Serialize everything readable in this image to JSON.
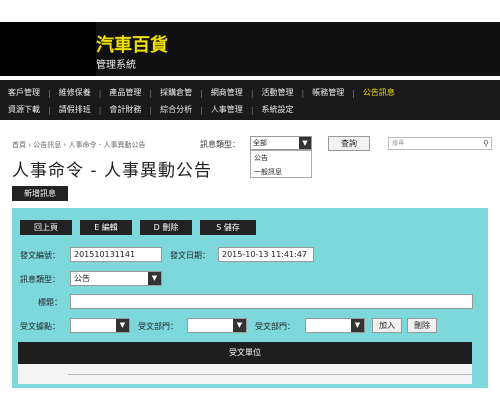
{
  "header": {
    "title": "汽車百貨",
    "subtitle": "管理系統"
  },
  "nav": {
    "row1": [
      "客戶管理",
      "維修保養",
      "產品管理",
      "採購倉管",
      "網商管理",
      "活動管理",
      "帳務管理",
      "公告訊息"
    ],
    "row2": [
      "資源下載",
      "請假排班",
      "會計財務",
      "綜合分析",
      "人事管理",
      "系統設定"
    ],
    "active": "公告訊息"
  },
  "breadcrumb": "首頁 › 公告訊息 › 人事命令 - 人事異動公告",
  "filter": {
    "label": "訊息類型：",
    "selected": "全部",
    "options": [
      "公告",
      "一般訊息"
    ],
    "query_label": "查詢",
    "search_placeholder": "搜尋"
  },
  "page_title": "人事命令 - 人事異動公告",
  "new_button": "新增訊息",
  "toolbar": {
    "back": "回上頁",
    "edit": "E 編輯",
    "delete": "D 刪除",
    "save": "S 儲存"
  },
  "form": {
    "doc_no_label": "發文編號：",
    "doc_no": "201510131141",
    "doc_date_label": "發文日期：",
    "doc_date": "2015-10-13 11:41:47",
    "msg_type_label": "訊息類型：",
    "msg_type": "公告",
    "title_label": "標題：",
    "title_value": "",
    "recipient_label": "受文據點：",
    "recipient_value": "",
    "dept1_label": "受文部門：",
    "dept1_value": "",
    "dept2_label": "受文部門：",
    "dept2_value": "",
    "add_label": "加入",
    "remove_label": "刪除",
    "unit_header": "受文單位"
  },
  "colors": {
    "accent": "#f0e000",
    "panel": "#7dd8dc",
    "dark": "#222222"
  }
}
